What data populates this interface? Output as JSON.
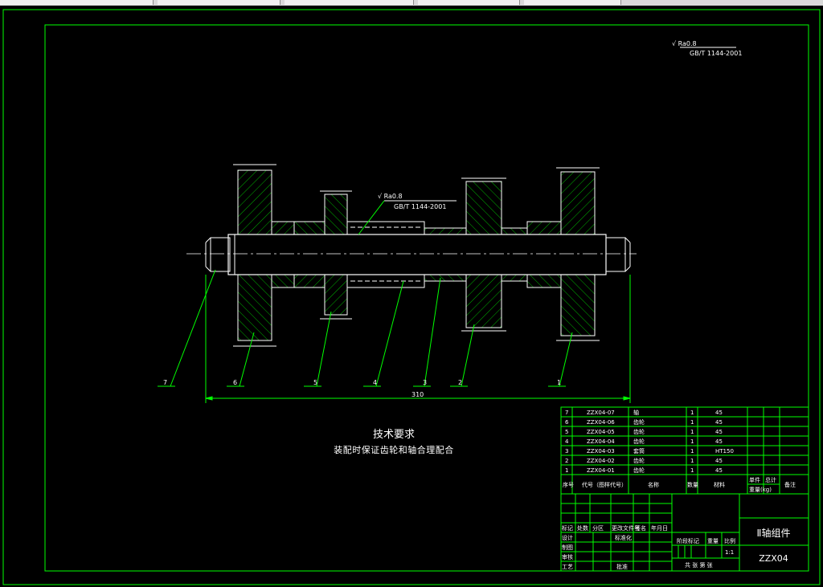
{
  "window": {
    "tabs": [
      "",
      "",
      "",
      "",
      ""
    ]
  },
  "drawing": {
    "surface_callout_top": [
      "√ Ra0.8",
      "GB/T 1144-2001"
    ],
    "surface_callout_mid": [
      "√ Ra0.8",
      "GB/T 1144-2001"
    ],
    "leader_numbers": [
      "7",
      "6",
      "5",
      "4",
      "3",
      "2",
      "1"
    ],
    "overall_dimension": "310"
  },
  "tech_requirements": {
    "title": "技术要求",
    "body": "装配时保证齿轮和轴合理配合"
  },
  "bom": {
    "rows": [
      {
        "no": "7",
        "code": "ZZX04-07",
        "name": "轴",
        "qty": "1",
        "material": "45"
      },
      {
        "no": "6",
        "code": "ZZX04-06",
        "name": "齿轮",
        "qty": "1",
        "material": "45"
      },
      {
        "no": "5",
        "code": "ZZX04-05",
        "name": "齿轮",
        "qty": "1",
        "material": "45"
      },
      {
        "no": "4",
        "code": "ZZX04-04",
        "name": "齿轮",
        "qty": "1",
        "material": "45"
      },
      {
        "no": "3",
        "code": "ZZX04-03",
        "name": "套筒",
        "qty": "1",
        "material": "HT150"
      },
      {
        "no": "2",
        "code": "ZZX04-02",
        "name": "齿轮",
        "qty": "1",
        "material": "45"
      },
      {
        "no": "1",
        "code": "ZZX04-01",
        "name": "齿轮",
        "qty": "1",
        "material": "45"
      }
    ],
    "header": {
      "no": "序号",
      "code": "代号（图样代号）",
      "name": "名称",
      "qty": "数量",
      "material": "材料",
      "unit_weight": "单件",
      "total_weight": "总计",
      "weight": "重量(kg)",
      "remark": "备注"
    }
  },
  "title_block": {
    "labels": {
      "mark": "标记",
      "count": "处数",
      "zone": "分区",
      "change_doc": "更改文件号",
      "signature": "签名",
      "date": "年月日",
      "design": "设计",
      "standardization": "标准化",
      "drawing": "制图",
      "review": "审核",
      "process": "工艺",
      "approve": "批准",
      "stage_mark": "阶段标记",
      "weight": "重量",
      "scale": "比例",
      "sheets": "共  张  第  张"
    },
    "scale_value": "1:1",
    "drawing_name": "Ⅱ轴组件",
    "drawing_code": "ZZX04"
  },
  "colors": {
    "line_green": "#00ff00",
    "line_white": "#ffffff",
    "hatch": "#00c000",
    "background": "#000000"
  }
}
